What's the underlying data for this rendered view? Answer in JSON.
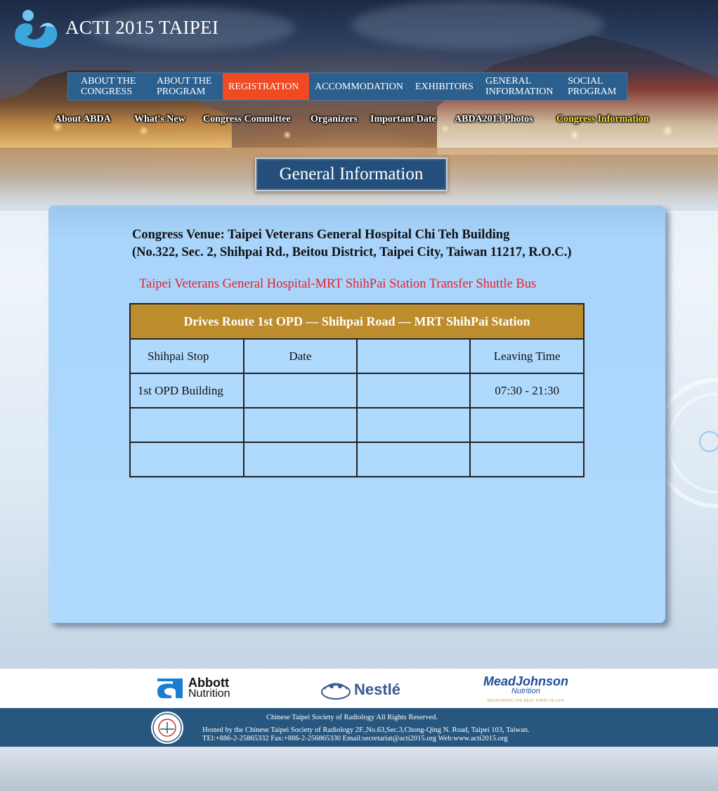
{
  "site": {
    "title": "ACTI 2015 TAIPEI"
  },
  "main_nav": [
    {
      "label": "ABOUT THE\nCONGRESS",
      "active": false
    },
    {
      "label": "ABOUT THE\nPROGRAM",
      "active": false
    },
    {
      "label": "REGISTRATION",
      "active": true
    },
    {
      "label": "ACCOMMODATION",
      "active": false
    },
    {
      "label": "EXHIBITORS",
      "active": false
    },
    {
      "label": "GENERAL\nINFORMATION",
      "active": false
    },
    {
      "label": "SOCIAL\nPROGRAM",
      "active": false
    }
  ],
  "sub_nav": [
    {
      "label": "About ABDA",
      "active": false
    },
    {
      "label": "What's New",
      "active": false
    },
    {
      "label": "Congress Committee",
      "active": false
    },
    {
      "label": "Organizers",
      "active": false
    },
    {
      "label": "Important Date",
      "active": false
    },
    {
      "label": "ABDA2013 Photos",
      "active": false
    },
    {
      "label": "Congress Information",
      "active": true
    }
  ],
  "page_heading": "General Information",
  "content": {
    "venue_line1": "Congress Venue: Taipei Veterans General Hospital Chi Teh Building",
    "venue_line2": "(No.322, Sec. 2, Shihpai Rd., Beitou District, Taipei City, Taiwan 11217, R.O.C.)",
    "shuttle_title": "Taipei Veterans General Hospital-MRT ShihPai Station Transfer Shuttle Bus",
    "table": {
      "header": "Drives Route  1st OPD — Shihpai Road — MRT ShihPai Station",
      "columns": [
        "Shihpai Stop",
        "Date",
        "",
        "Leaving Time"
      ],
      "rows": [
        [
          "1st OPD Building",
          "",
          "",
          "07:30 - 21:30"
        ],
        [
          "",
          "",
          "",
          ""
        ],
        [
          "",
          "",
          "",
          ""
        ]
      ]
    }
  },
  "sponsors": {
    "abbott_line1": "Abbott",
    "abbott_line2": "Nutrition",
    "nestle": "Nestlé",
    "mead_johnson_line1": "MeadJohnson",
    "mead_johnson_line2": "Nutrition",
    "mead_johnson_tagline": "NOURISHING THE BEST START IN LIFE"
  },
  "footer": {
    "copyright": "Chinese Taipei Society of Radiology  All Rights Reserved.",
    "hosted": "Hosted by the Chinese Taipei Society of Radiology   2F.,No.63,Sec.3,Chong-Qing N. Road, Taipei 103, Taiwan.",
    "contact": "TEl:+886-2-25865332 Fax:+886-2-256865330      Email:secretariat@acti2015.org Web:www.acti2015.org"
  },
  "colors": {
    "nav_bg": "#2a5f8e",
    "nav_active": "#ef4a22",
    "sub_active": "#ffe933",
    "table_header": "#bd8c2c",
    "panel_bg": "#b0dafd",
    "shuttle_title": "#e8202a",
    "footer_bg": "#27577f"
  }
}
